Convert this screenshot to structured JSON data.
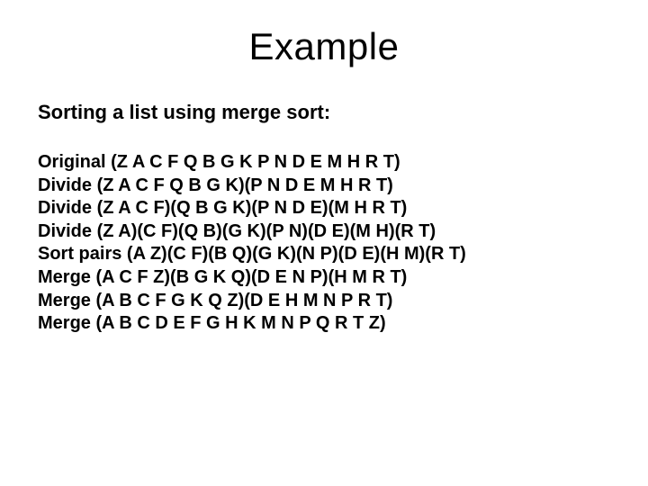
{
  "title": "Example",
  "subtitle": "Sorting a list using merge sort:",
  "steps": [
    "Original (Z A C F Q B G K P N D E M H R T)",
    "Divide (Z A C F Q B G K)(P N D E M H R T)",
    "Divide (Z A C F)(Q B G K)(P N D E)(M H R T)",
    "Divide (Z A)(C F)(Q B)(G K)(P N)(D E)(M H)(R T)",
    "Sort pairs (A Z)(C F)(B Q)(G K)(N P)(D E)(H M)(R T)",
    "Merge (A C F Z)(B G K Q)(D E N P)(H M R T)",
    "Merge (A B C F G K Q Z)(D E H M N P R T)",
    "Merge (A B C D E F G H K M N P Q R T Z)"
  ]
}
